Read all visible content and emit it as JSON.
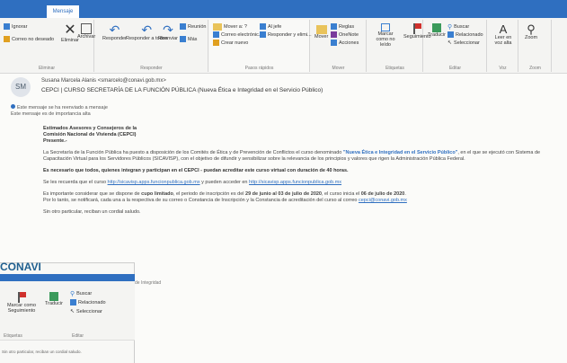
{
  "ribbon": {
    "active_tab": "Mensaje",
    "ignorar": "Ignorar",
    "correo_deseado": "Correo no deseado",
    "eliminar": "Eliminar",
    "archivar": "Archivar",
    "responder": "Responder",
    "responder_todos": "Responder a todos",
    "reenviar": "Reenviar",
    "reunion": "Reunión",
    "mas": "Más",
    "pasos1": "Mover a: ?",
    "pasos2": "Correo electrónic...",
    "pasos3": "Crear nuevo",
    "pasos4": "Al jefe",
    "pasos5": "Responder y elimi...",
    "mover": "Mover",
    "reglas": "Reglas",
    "onenote": "OneNote",
    "acciones": "Acciones",
    "marcar_leido": "Marcar como no leído",
    "seguimiento": "Seguimiento",
    "traducir": "Traducir",
    "buscar": "Buscar",
    "relacionado": "Relacionado",
    "seleccionar": "Seleccionar",
    "leer_voz": "Leer en voz alta",
    "zoom": "Zoom",
    "labels": [
      "Eliminar",
      "Responder",
      "Pasos rápidos",
      "Mover",
      "Etiquetas",
      "Editar",
      "Voz",
      "Zoom"
    ]
  },
  "message": {
    "avatar": "SM",
    "sender": "Susana Marcela Alanis <smarcelo@conavi.gob.mx>",
    "subject": "CEPCI | CURSO SECRETARÍA DE LA FUNCIÓN PÚBLICA (Nueva Ética e Integridad en el Servicio Público)",
    "notice1": "Este mensaje se ha reenviado a mensaje",
    "notice2": "Este mensaje es de importancia alta",
    "greeting1": "Estimados Asesores y Consejeros de la",
    "greeting2": "Comisión Nacional de Vivienda (CEPCI)",
    "greeting3": "Presente.-",
    "p1a": "La Secretaría de la Función Pública ha puesto a disposición de los Comités de Ética y de Prevención de Conflictos el curso denominado ",
    "p1b": "\"Nueva Ética e Integridad en el Servicio Público\"",
    "p1c": ", en el que se ejecutó con Sistema de Capacitación Virtual para los Servidores Públicos (SICAVISP), con el objetivo de difundir y sensibilizar sobre la relevancia de los principios y valores que rigen la Administración Pública Federal.",
    "p2": "Es necesario que todos, quienes integran y participan en el CEPCI - puedan acreditar este curso virtual con duración de 40 horas.",
    "p3a": "Se les recuerda que el curso ",
    "p3link1": "http://sicavisp.apps.funcionpublica.gob.mx",
    "p3b": " y pueden acceder en ",
    "p3link2": "http://sicavisp.apps.funcionpublica.gob.mx",
    "p4a": "Es importante considerar que se dispone de ",
    "p4b": "cupo limitado",
    "p4c": ", el periodo de inscripción es del ",
    "p4d": "29 de junio al 03 de julio de 2020",
    "p4e": ", el curso inicia el ",
    "p4f": "06 de julio de 2020",
    "p4g": ".",
    "p5a": "Por lo tanto, se notificará, cada una a la respectiva de su correo o Constancia de Inscripción y la Constancia de acreditación del curso al correo ",
    "p5link": "cepci@conavi.gob.mx",
    "p6": "Sin otro particular, reciban un cordial saludo."
  },
  "fragment": {
    "title": "CONAVI",
    "buscar": "Buscar",
    "relacionado": "Relacionado",
    "seleccionar": "Seleccionar",
    "seguimiento": "Marcar como Seguimiento",
    "traducir": "Traducir",
    "editar": "Editar",
    "etiquetas": "Etiquetas",
    "foot": "Sin otro particular, reciban un cordial saludo.",
    "ext": "de Integridad"
  }
}
